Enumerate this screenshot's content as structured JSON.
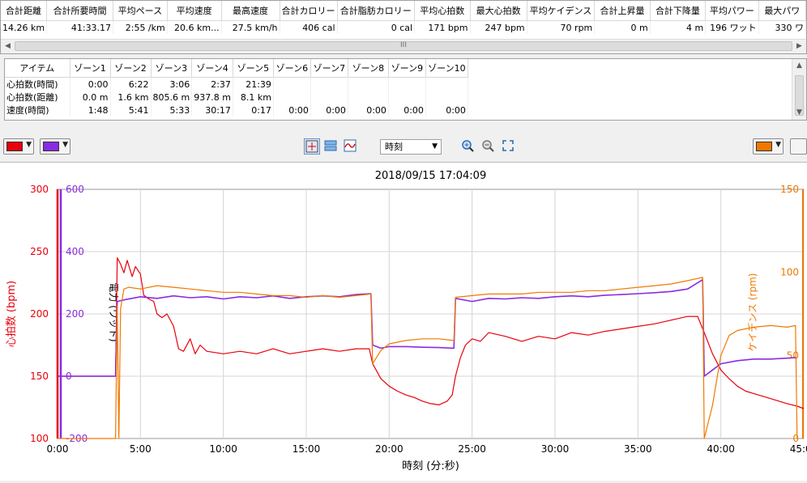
{
  "summary": {
    "headers": [
      "合計距離",
      "合計所要時間",
      "平均ペース",
      "平均速度",
      "最高速度",
      "合計カロリー",
      "合計脂肪カロリー",
      "平均心拍数",
      "最大心拍数",
      "平均ケイデンス",
      "合計上昇量",
      "合計下降量",
      "平均パワー",
      "最大パワ"
    ],
    "values": [
      "14.26 km",
      "41:33.17",
      "2:55 /km",
      "20.6 km...",
      "27.5 km/h",
      "406 cal",
      "0 cal",
      "171 bpm",
      "247 bpm",
      "70 rpm",
      "0 m",
      "4 m",
      "196 ワット",
      "330 ワ"
    ],
    "scroll_glyph": "III"
  },
  "zones": {
    "headers": [
      "アイテム",
      "ゾーン1",
      "ゾーン2",
      "ゾーン3",
      "ゾーン4",
      "ゾーン5",
      "ゾーン6",
      "ゾーン7",
      "ゾーン8",
      "ゾーン9",
      "ゾーン10"
    ],
    "rows": [
      {
        "label": "心拍数(時間)",
        "values": [
          "0:00",
          "6:22",
          "3:06",
          "2:37",
          "21:39",
          "",
          "",
          "",
          "",
          ""
        ]
      },
      {
        "label": "心拍数(距離)",
        "values": [
          "0.0 m",
          "1.6 km",
          "805.6 m",
          "937.8 m",
          "8.1 km",
          "",
          "",
          "",
          "",
          ""
        ]
      },
      {
        "label": "速度(時間)",
        "values": [
          "1:48",
          "5:41",
          "5:33",
          "30:17",
          "0:17",
          "0:00",
          "0:00",
          "0:00",
          "0:00",
          "0:00"
        ]
      }
    ]
  },
  "toolbar": {
    "left_color_1": "#e8000b",
    "left_color_2": "#8a2be2",
    "right_color": "#f07800",
    "xaxis_select": "時刻",
    "icons": [
      "crosshair-icon",
      "split-view-icon",
      "smooth-line-icon",
      "zoom-in-icon",
      "zoom-out-icon",
      "fit-icon"
    ]
  },
  "chart_data": {
    "type": "line",
    "title": "2018/09/15 17:04:09",
    "xlabel": "時刻 (分:秒)",
    "x_ticks": [
      "0:00",
      "5:00",
      "10:00",
      "15:00",
      "20:00",
      "25:00",
      "30:00",
      "35:00",
      "40:00",
      "45:00"
    ],
    "xlim_min": [
      0,
      45
    ],
    "grid": true,
    "axes": [
      {
        "side": "left-outer",
        "label": "心拍数 (bpm)",
        "color": "#e8000b",
        "ylim": [
          100,
          300
        ],
        "ticks": [
          "100",
          "150",
          "200",
          "250",
          "300"
        ]
      },
      {
        "side": "left-inner",
        "label": "電力 (ワット)",
        "color": "#8a2be2",
        "ylim": [
          -200,
          600
        ],
        "ticks": [
          "-200",
          "0",
          "200",
          "400",
          "600"
        ]
      },
      {
        "side": "right",
        "label": "ケイデンス (rpm)",
        "color": "#f07800",
        "ylim": [
          0,
          150
        ],
        "ticks": [
          "0",
          "50",
          "100",
          "150"
        ]
      }
    ],
    "series": [
      {
        "name": "心拍数",
        "axis": 0,
        "color": "#e8000b",
        "points": [
          [
            0,
            150
          ],
          [
            3.5,
            150
          ],
          [
            3.6,
            245
          ],
          [
            3.8,
            240
          ],
          [
            4.0,
            233
          ],
          [
            4.2,
            243
          ],
          [
            4.5,
            230
          ],
          [
            4.7,
            238
          ],
          [
            5.0,
            232
          ],
          [
            5.2,
            215
          ],
          [
            5.5,
            212
          ],
          [
            5.8,
            210
          ],
          [
            6.0,
            200
          ],
          [
            6.3,
            197
          ],
          [
            6.6,
            200
          ],
          [
            7.0,
            190
          ],
          [
            7.3,
            172
          ],
          [
            7.6,
            170
          ],
          [
            8.0,
            180
          ],
          [
            8.3,
            168
          ],
          [
            8.6,
            175
          ],
          [
            9.0,
            170
          ],
          [
            10,
            168
          ],
          [
            11,
            170
          ],
          [
            12,
            168
          ],
          [
            13,
            172
          ],
          [
            14,
            168
          ],
          [
            15,
            170
          ],
          [
            16,
            172
          ],
          [
            17,
            170
          ],
          [
            18,
            172
          ],
          [
            18.8,
            172
          ],
          [
            19.0,
            160
          ],
          [
            19.5,
            148
          ],
          [
            20,
            142
          ],
          [
            20.5,
            138
          ],
          [
            21,
            135
          ],
          [
            21.5,
            133
          ],
          [
            22,
            130
          ],
          [
            22.5,
            128
          ],
          [
            23,
            127
          ],
          [
            23.5,
            130
          ],
          [
            23.8,
            135
          ],
          [
            24.0,
            150
          ],
          [
            24.3,
            165
          ],
          [
            24.6,
            175
          ],
          [
            25,
            180
          ],
          [
            25.5,
            178
          ],
          [
            26,
            185
          ],
          [
            27,
            182
          ],
          [
            28,
            178
          ],
          [
            29,
            182
          ],
          [
            30,
            180
          ],
          [
            31,
            185
          ],
          [
            32,
            183
          ],
          [
            33,
            186
          ],
          [
            34,
            188
          ],
          [
            35,
            190
          ],
          [
            36,
            192
          ],
          [
            37,
            195
          ],
          [
            38,
            198
          ],
          [
            38.6,
            198
          ],
          [
            39.0,
            185
          ],
          [
            39.5,
            168
          ],
          [
            40,
            155
          ],
          [
            40.5,
            148
          ],
          [
            41,
            142
          ],
          [
            41.5,
            138
          ],
          [
            42,
            136
          ],
          [
            43,
            132
          ],
          [
            44,
            128
          ],
          [
            44.6,
            126
          ],
          [
            45,
            124
          ]
        ]
      },
      {
        "name": "電力",
        "axis": 1,
        "color": "#8a2be2",
        "points": [
          [
            0,
            0
          ],
          [
            3.5,
            0
          ],
          [
            3.6,
            240
          ],
          [
            4.0,
            245
          ],
          [
            5,
            255
          ],
          [
            6,
            250
          ],
          [
            7,
            258
          ],
          [
            8,
            252
          ],
          [
            9,
            255
          ],
          [
            10,
            248
          ],
          [
            11,
            255
          ],
          [
            12,
            252
          ],
          [
            13,
            258
          ],
          [
            14,
            250
          ],
          [
            15,
            255
          ],
          [
            16,
            258
          ],
          [
            17,
            255
          ],
          [
            18,
            262
          ],
          [
            18.9,
            265
          ],
          [
            19.0,
            100
          ],
          [
            19.5,
            90
          ],
          [
            20,
            95
          ],
          [
            21,
            95
          ],
          [
            22,
            93
          ],
          [
            23,
            92
          ],
          [
            23.9,
            90
          ],
          [
            24.0,
            250
          ],
          [
            25,
            240
          ],
          [
            26,
            250
          ],
          [
            27,
            248
          ],
          [
            28,
            252
          ],
          [
            29,
            250
          ],
          [
            30,
            255
          ],
          [
            31,
            258
          ],
          [
            32,
            255
          ],
          [
            33,
            260
          ],
          [
            34,
            262
          ],
          [
            35,
            265
          ],
          [
            36,
            268
          ],
          [
            37,
            272
          ],
          [
            38,
            280
          ],
          [
            38.9,
            310
          ],
          [
            39.0,
            0
          ],
          [
            39.5,
            20
          ],
          [
            40,
            40
          ],
          [
            41,
            50
          ],
          [
            42,
            55
          ],
          [
            43,
            55
          ],
          [
            44,
            58
          ],
          [
            44.5,
            60
          ]
        ]
      },
      {
        "name": "ケイデンス",
        "axis": 2,
        "color": "#f07800",
        "points": [
          [
            0,
            0
          ],
          [
            3.5,
            0
          ],
          [
            3.6,
            80
          ],
          [
            3.7,
            0
          ],
          [
            3.8,
            78
          ],
          [
            4.0,
            90
          ],
          [
            4.3,
            91
          ],
          [
            5,
            90
          ],
          [
            6,
            92
          ],
          [
            7,
            91
          ],
          [
            8,
            90
          ],
          [
            9,
            89
          ],
          [
            10,
            88
          ],
          [
            11,
            88
          ],
          [
            12,
            87
          ],
          [
            13,
            86
          ],
          [
            14,
            86
          ],
          [
            15,
            85
          ],
          [
            16,
            86
          ],
          [
            17,
            85
          ],
          [
            18,
            86
          ],
          [
            18.9,
            87
          ],
          [
            19.0,
            45
          ],
          [
            19.5,
            53
          ],
          [
            20,
            57
          ],
          [
            21,
            59
          ],
          [
            22,
            60
          ],
          [
            23,
            60
          ],
          [
            23.9,
            59
          ],
          [
            24.0,
            85
          ],
          [
            25,
            86
          ],
          [
            26,
            87
          ],
          [
            27,
            87
          ],
          [
            28,
            87
          ],
          [
            29,
            88
          ],
          [
            30,
            88
          ],
          [
            31,
            88
          ],
          [
            32,
            89
          ],
          [
            33,
            89
          ],
          [
            34,
            90
          ],
          [
            35,
            91
          ],
          [
            36,
            92
          ],
          [
            37,
            93
          ],
          [
            38,
            95
          ],
          [
            38.9,
            97
          ],
          [
            39.0,
            0
          ],
          [
            39.5,
            20
          ],
          [
            40,
            50
          ],
          [
            40.5,
            62
          ],
          [
            41,
            65
          ],
          [
            42,
            67
          ],
          [
            43,
            68
          ],
          [
            44,
            67
          ],
          [
            44.5,
            68
          ],
          [
            44.6,
            0
          ]
        ]
      }
    ]
  }
}
